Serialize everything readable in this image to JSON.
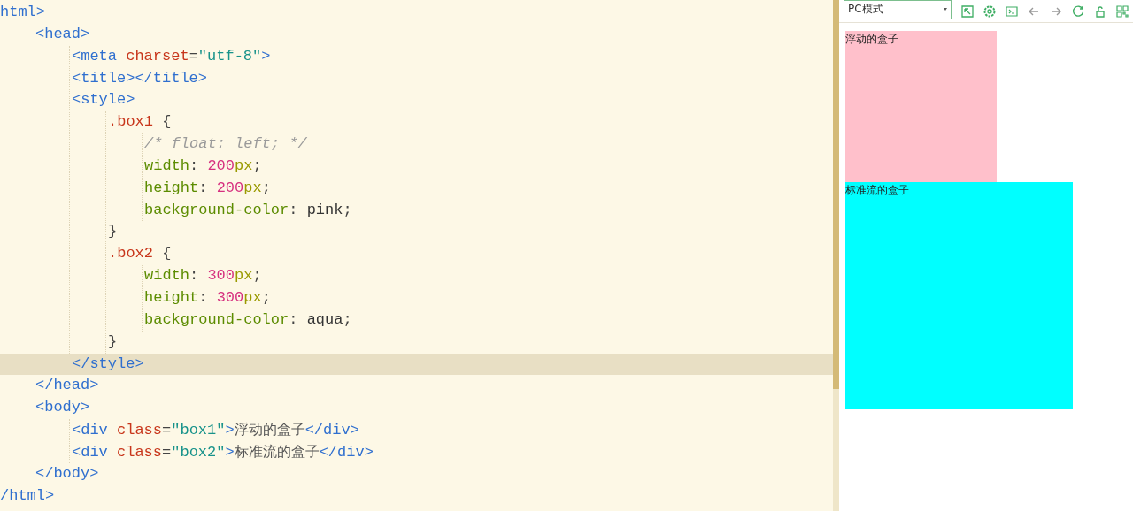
{
  "editor": {
    "lines": [
      {
        "current": false,
        "tokens": [
          {
            "kind": "tag",
            "text": "html>"
          }
        ],
        "children": [
          {
            "current": false,
            "tokens": [
              {
                "kind": "tag",
                "text": "<head>"
              }
            ],
            "children": [
              {
                "current": false,
                "tokens": [
                  {
                    "kind": "tag",
                    "text": "<meta "
                  },
                  {
                    "kind": "attr",
                    "text": "charset"
                  },
                  {
                    "kind": "punct",
                    "text": "="
                  },
                  {
                    "kind": "str",
                    "text": "\"utf-8\""
                  },
                  {
                    "kind": "tag",
                    "text": ">"
                  }
                ]
              },
              {
                "current": false,
                "tokens": [
                  {
                    "kind": "tag",
                    "text": "<title></title>"
                  }
                ]
              },
              {
                "current": false,
                "tokens": [
                  {
                    "kind": "tag",
                    "text": "<style>"
                  }
                ],
                "children": [
                  {
                    "current": false,
                    "tokens": [
                      {
                        "kind": "attr",
                        "text": ".box1"
                      },
                      {
                        "kind": "punct",
                        "text": " {"
                      }
                    ],
                    "children": [
                      {
                        "current": false,
                        "tokens": [
                          {
                            "kind": "comment",
                            "text": "/* float: left; */"
                          }
                        ]
                      },
                      {
                        "current": false,
                        "tokens": [
                          {
                            "kind": "prop",
                            "text": "width"
                          },
                          {
                            "kind": "punct",
                            "text": ": "
                          },
                          {
                            "kind": "num",
                            "text": "200"
                          },
                          {
                            "kind": "unit",
                            "text": "px"
                          },
                          {
                            "kind": "punct",
                            "text": ";"
                          }
                        ]
                      },
                      {
                        "current": false,
                        "tokens": [
                          {
                            "kind": "prop",
                            "text": "height"
                          },
                          {
                            "kind": "punct",
                            "text": ": "
                          },
                          {
                            "kind": "num",
                            "text": "200"
                          },
                          {
                            "kind": "unit",
                            "text": "px"
                          },
                          {
                            "kind": "punct",
                            "text": ";"
                          }
                        ]
                      },
                      {
                        "current": false,
                        "tokens": [
                          {
                            "kind": "prop",
                            "text": "background-color"
                          },
                          {
                            "kind": "punct",
                            "text": ": "
                          },
                          {
                            "kind": "val",
                            "text": "pink"
                          },
                          {
                            "kind": "punct",
                            "text": ";"
                          }
                        ]
                      }
                    ]
                  },
                  {
                    "current": false,
                    "tokens": [
                      {
                        "kind": "punct",
                        "text": "}"
                      }
                    ]
                  },
                  {
                    "current": false,
                    "tokens": [
                      {
                        "kind": "attr",
                        "text": ".box2"
                      },
                      {
                        "kind": "punct",
                        "text": " {"
                      }
                    ],
                    "children": [
                      {
                        "current": false,
                        "tokens": [
                          {
                            "kind": "prop",
                            "text": "width"
                          },
                          {
                            "kind": "punct",
                            "text": ": "
                          },
                          {
                            "kind": "num",
                            "text": "300"
                          },
                          {
                            "kind": "unit",
                            "text": "px"
                          },
                          {
                            "kind": "punct",
                            "text": ";"
                          }
                        ]
                      },
                      {
                        "current": false,
                        "tokens": [
                          {
                            "kind": "prop",
                            "text": "height"
                          },
                          {
                            "kind": "punct",
                            "text": ": "
                          },
                          {
                            "kind": "num",
                            "text": "300"
                          },
                          {
                            "kind": "unit",
                            "text": "px"
                          },
                          {
                            "kind": "punct",
                            "text": ";"
                          }
                        ]
                      },
                      {
                        "current": false,
                        "tokens": [
                          {
                            "kind": "prop",
                            "text": "background-color"
                          },
                          {
                            "kind": "punct",
                            "text": ": "
                          },
                          {
                            "kind": "val",
                            "text": "aqua"
                          },
                          {
                            "kind": "punct",
                            "text": ";"
                          }
                        ]
                      }
                    ]
                  },
                  {
                    "current": false,
                    "tokens": [
                      {
                        "kind": "punct",
                        "text": "}"
                      }
                    ]
                  }
                ]
              },
              {
                "current": true,
                "tokens": [
                  {
                    "kind": "tag",
                    "text": "</style>"
                  }
                ]
              }
            ]
          },
          {
            "current": false,
            "tokens": [
              {
                "kind": "tag",
                "text": "</head>"
              }
            ]
          },
          {
            "current": false,
            "tokens": [
              {
                "kind": "tag",
                "text": "<body>"
              }
            ],
            "children": [
              {
                "current": false,
                "tokens": [
                  {
                    "kind": "tag",
                    "text": "<div "
                  },
                  {
                    "kind": "attr",
                    "text": "class"
                  },
                  {
                    "kind": "punct",
                    "text": "="
                  },
                  {
                    "kind": "str",
                    "text": "\"box1\""
                  },
                  {
                    "kind": "tag",
                    "text": ">"
                  },
                  {
                    "kind": "text",
                    "text": "浮动的盒子"
                  },
                  {
                    "kind": "tag",
                    "text": "</div>"
                  }
                ]
              },
              {
                "current": false,
                "tokens": [
                  {
                    "kind": "tag",
                    "text": "<div "
                  },
                  {
                    "kind": "attr",
                    "text": "class"
                  },
                  {
                    "kind": "punct",
                    "text": "="
                  },
                  {
                    "kind": "str",
                    "text": "\"box2\""
                  },
                  {
                    "kind": "tag",
                    "text": ">"
                  },
                  {
                    "kind": "text",
                    "text": "标准流的盒子"
                  },
                  {
                    "kind": "tag",
                    "text": "</div>"
                  }
                ]
              }
            ]
          },
          {
            "current": false,
            "tokens": [
              {
                "kind": "tag",
                "text": "</body>"
              }
            ]
          }
        ]
      },
      {
        "current": false,
        "tokens": [
          {
            "kind": "tag",
            "text": "/html>"
          }
        ]
      }
    ]
  },
  "preview": {
    "mode_select": {
      "value": "PC模式"
    },
    "boxes": [
      {
        "text": "浮动的盒子",
        "color": "#ffc0cb"
      },
      {
        "text": "标准流的盒子",
        "color": "#00ffff"
      }
    ]
  }
}
